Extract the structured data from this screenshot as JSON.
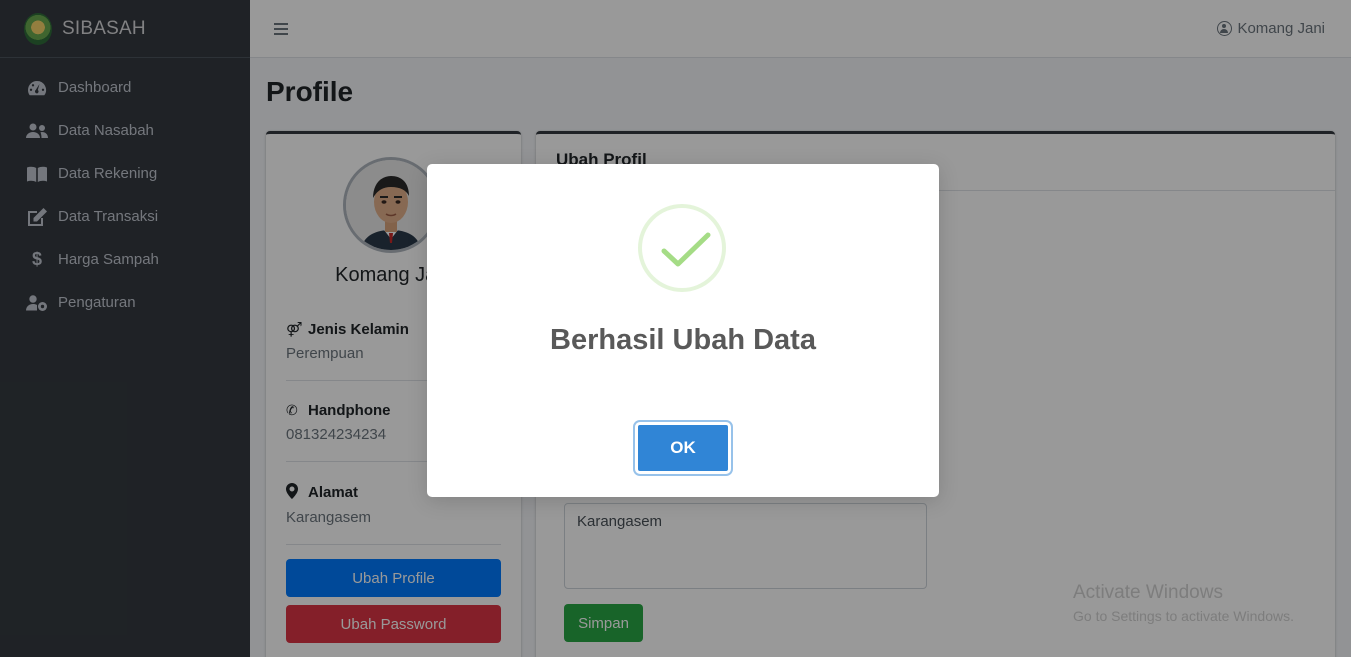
{
  "app": {
    "brand": "SIBASAH"
  },
  "sidebar": {
    "items": [
      {
        "label": "Dashboard",
        "icon": "tachometer-icon"
      },
      {
        "label": "Data Nasabah",
        "icon": "users-icon"
      },
      {
        "label": "Data Rekening",
        "icon": "book-icon"
      },
      {
        "label": "Data Transaksi",
        "icon": "edit-icon"
      },
      {
        "label": "Harga Sampah",
        "icon": "dollar-icon"
      },
      {
        "label": "Pengaturan",
        "icon": "user-cog-icon"
      }
    ]
  },
  "header": {
    "user_name": "Komang Jani"
  },
  "page": {
    "title": "Profile"
  },
  "profile_card": {
    "name": "Komang Jani",
    "gender_label": "Jenis Kelamin",
    "gender_value": "Perempuan",
    "phone_label": "Handphone",
    "phone_value": "081324234234",
    "address_label": "Alamat",
    "address_value": "Karangasem",
    "edit_profile_button": "Ubah Profile",
    "edit_password_button": "Ubah Password"
  },
  "edit_card": {
    "title": "Ubah Profil",
    "address_value": "Karangasem",
    "save_button": "Simpan"
  },
  "watermark": {
    "title": "Activate Windows",
    "subtitle": "Go to Settings to activate Windows."
  },
  "modal": {
    "title": "Berhasil Ubah Data",
    "ok_button": "OK",
    "success_color": "#a5dc86",
    "button_color": "#3085d6"
  }
}
